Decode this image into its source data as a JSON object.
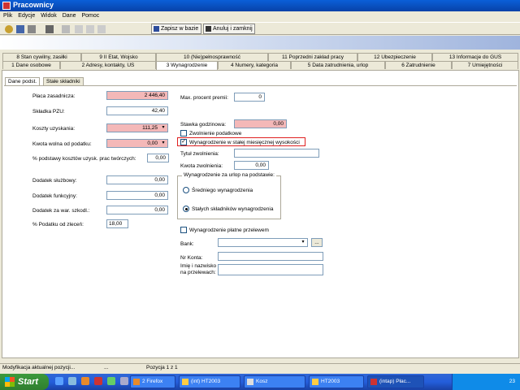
{
  "window": {
    "title": "Pracownicy"
  },
  "menu": [
    "Plik",
    "Edycje",
    "Widok",
    "Dane",
    "Pomoc"
  ],
  "toolbar": {
    "save_label": "Zapisz w bazie",
    "cancel_label": "Anuluj i zamknij"
  },
  "tabs_row1": [
    "8 Stan cywilny, zasiłki",
    "9 II Etat, Wojsko",
    "10 (Nie)pełnosprawność",
    "11 Poprzedni zakład pracy",
    "12 Ubezpieczenie",
    "13 Informacje do GUS"
  ],
  "tabs_row2": [
    "1 Dane osobowe",
    "2 Adresy, kontakty, US",
    "3 Wynagrodzenie",
    "4 Numery, kategoria",
    "5 Data zatrudnienia, urlop",
    "6 Zatrudnienie",
    "7 Umiejętności"
  ],
  "subtabs": [
    "Dane podst.",
    "Stałe składniki"
  ],
  "left_fields": {
    "placa_label": "Płaca zasadnicza:",
    "placa_value": "2 446,40",
    "pzu_label": "Składka PZU:",
    "pzu_value": "42,40",
    "koszty_label": "Koszty uzyskania:",
    "koszty_value": "111,25",
    "kwota_wolna_label": "Kwota wolna od podatku:",
    "kwota_wolna_value": "0,00",
    "procent_kosztow_label": "% podstawy kosztów uzysk. prac twórczych:",
    "procent_kosztow_value": "0,00",
    "dod_sluzbowy_label": "Dodatek służbowy:",
    "dod_sluzbowy_value": "0,00",
    "dod_funkcyjny_label": "Dodatek funkcyjny:",
    "dod_funkcyjny_value": "0,00",
    "dod_szkodl_label": "Dodatek za war. szkodl.:",
    "dod_szkodl_value": "0,00",
    "podatek_zlecen_label": "% Podatku od zleceń:",
    "podatek_zlecen_value": "18,00"
  },
  "right_fields": {
    "max_premii_label": "Max. procent premii:",
    "max_premii_value": "0",
    "stawka_label": "Stawka godzinowa:",
    "stawka_value": "0,00",
    "zwolnienie_podatkowe_label": "Zwolnienie podatkowe",
    "stala_wysokosc_label": "Wynagrodzenie w stałej miesięcznej wysokości",
    "tytul_label": "Tytuł zwolnienia:",
    "tytul_value": "",
    "kwota_zwolnienia_label": "Kwota zwolnienia:",
    "kwota_zwolnienia_value": "0,00",
    "urlop_group_label": "Wynagrodzenie za urlop na podstawie:",
    "radio_srednie": "Średniego wynagrodzenia",
    "radio_stale": "Stałych składników wynagrodzenia",
    "przelew_label": "Wynagrodzenie płatne przelewem",
    "bank_label": "Bank:",
    "bank_btn": "...",
    "konto_label": "Nr Konta:",
    "imie_label_1": "Imię i nazwisko",
    "imie_label_2": "na przelewach:"
  },
  "checkboxes": {
    "zwolnienie_podatkowe": false,
    "stala_wysokosc": true,
    "przelew": false
  },
  "status": {
    "left": "Modyfikacja aktualnej pozycji...",
    "middle": "...",
    "position": "Pozycja 1 z 1"
  },
  "taskbar": {
    "start": "Start",
    "tasks": [
      "2 Firefox",
      "(int) HT2003",
      "Kosz",
      "HT2003",
      "(intap) Płac..."
    ],
    "clock": "23"
  }
}
